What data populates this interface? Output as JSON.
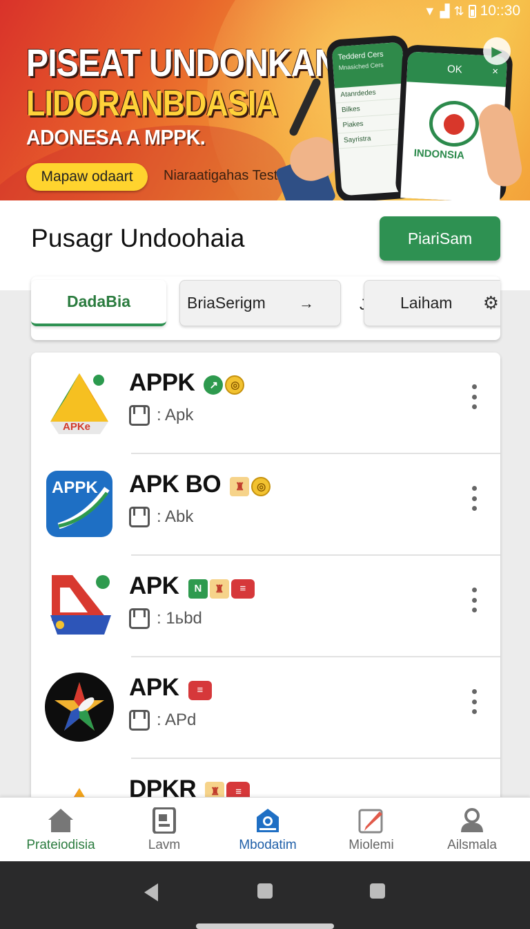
{
  "status_bar": {
    "time": "10::30"
  },
  "banner": {
    "title_line1": "PISEAT UNDONKAN",
    "title_line2": "LIDORANBDASIA",
    "subtitle": "ADONESA A MPPK.",
    "cta_label": "Mapaw odaart",
    "note": "Niaraatigahas Test.",
    "phone1": {
      "header": "Tedderd Cers",
      "header_sub": "Mnasiched Cers",
      "rows": [
        "Atanrdedes",
        "Bilkes",
        "Piakes",
        "Sayristra"
      ]
    },
    "phone2": {
      "ok_label": "OK",
      "close_label": "×",
      "logo_text": "INDONSIA"
    }
  },
  "header": {
    "title": "Pusagr Undoohaia",
    "action_label": "PiariSam"
  },
  "tabs": [
    {
      "label": "DadaBia",
      "active": true
    },
    {
      "label": "BriaSerigm",
      "trail": "→"
    },
    {
      "label": "Laiham",
      "lead": "J"
    }
  ],
  "apps": [
    {
      "title": "APPK",
      "sub": ": Apk",
      "badges": [
        "badge-green",
        "badge-gold"
      ],
      "badge_glyphs": [
        "↗",
        "◎"
      ]
    },
    {
      "title": "APK BO",
      "sub": ": Abk",
      "badges": [
        "badge-gift",
        "badge-gold"
      ],
      "badge_glyphs": [
        "♜",
        "◎"
      ]
    },
    {
      "title": "APK",
      "sub": ": 1ьbd",
      "badges": [
        "badge-greensq",
        "badge-gift",
        "badge-red"
      ],
      "badge_glyphs": [
        "N",
        "♜",
        "≡"
      ]
    },
    {
      "title": "APK",
      "sub": ": APd",
      "badges": [
        "badge-red"
      ],
      "badge_glyphs": [
        "≡"
      ]
    },
    {
      "title": "DPKR",
      "sub": "",
      "badges": [
        "badge-gift",
        "badge-red"
      ],
      "badge_glyphs": [
        "♜",
        "≡"
      ]
    }
  ],
  "app_icon_texts": {
    "icon1": "APKe",
    "icon2": "APPK"
  },
  "bottom_nav": [
    {
      "label": "Prateiodisia",
      "icon": "home-icon"
    },
    {
      "label": "Lavm",
      "icon": "document-icon"
    },
    {
      "label": "Mbodatim",
      "icon": "store-icon",
      "active": true
    },
    {
      "label": "Miolemi",
      "icon": "edit-icon"
    },
    {
      "label": "Ailsmala",
      "icon": "user-icon"
    }
  ],
  "colors": {
    "brand_green": "#2e9152",
    "active_nav_blue": "#1f5fa8",
    "banner_orange": "#e8622b",
    "banner_yellow": "#ffd42e"
  }
}
